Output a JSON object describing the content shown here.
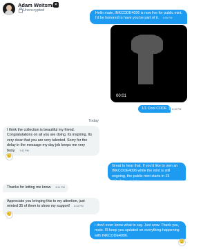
{
  "header": {
    "name": "Adam Weitsman",
    "status": "Unencrypted"
  },
  "messages": {
    "m1": {
      "text": "Hello mate, INKCODE4096 is now live for public mint. I'd be honored to have you be part of it.",
      "time": "6:06 PM"
    },
    "media": {
      "timer": "00:01"
    },
    "m2": {
      "text": "1/1 Cool CODE :)",
      "time": "6:10 PM"
    },
    "day": "Today",
    "m3": {
      "text": "I think the collection is beautiful my friend. Congratulations on all you are doing. Its inspiring. Its very clear that you are very talented. Sorry for the delay in the message my day job keeps me very busy.",
      "time": "7:42 PM",
      "reaction": "🙂"
    },
    "m4": {
      "text": "Great to hear that. If you'd like to own an INKCODE4096 while the mint is still ongoing, the public mint starts in 15 minutes.",
      "time": "7:45 PM"
    },
    "m5": {
      "text": "Thanks for letting me know.",
      "time": "8:11 PM"
    },
    "m6": {
      "text": "Appreciate you bringing this to my attention, just minted 35 of them to show my support!",
      "time": "8:32 PM",
      "reaction": "🙂"
    },
    "m7": {
      "text": "I don't even know what to say. Just wow. Thank you, mate. I'll keep you updated on everything happening with INKCODE4096.",
      "reaction": "🙂"
    }
  },
  "colors": {
    "accent": "#1d9bf0",
    "incoming_bg": "#eff3f4"
  }
}
